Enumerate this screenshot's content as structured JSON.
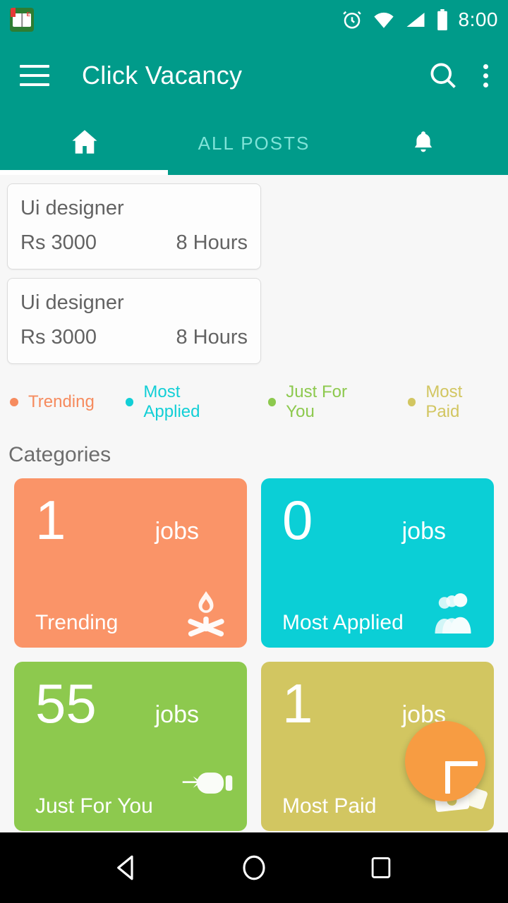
{
  "status_bar": {
    "notification_icon": "app-book-icon",
    "icons": [
      "alarm-icon",
      "wifi-icon",
      "signal-icon",
      "battery-icon"
    ],
    "time": "8:00"
  },
  "app_bar": {
    "menu_icon": "hamburger-menu-icon",
    "title": "Click Vacancy",
    "search_icon": "search-icon",
    "overflow_icon": "more-options-icon"
  },
  "tabs": [
    {
      "label": "",
      "icon": "home-icon",
      "active": true
    },
    {
      "label": "ALL POSTS",
      "icon": "",
      "active": false
    },
    {
      "label": "",
      "icon": "bell-icon",
      "active": false
    }
  ],
  "job_cards": [
    {
      "title": "Ui designer",
      "salary": "Rs 3000",
      "duration": "8 Hours"
    },
    {
      "title": "Ui designer",
      "salary": "Rs 3000",
      "duration": "8 Hours"
    }
  ],
  "legend": [
    {
      "label": "Trending",
      "color": "#f68b5e"
    },
    {
      "label": "Most Applied",
      "color": "#12cfd6"
    },
    {
      "label": "Just For You",
      "color": "#8dc94e"
    },
    {
      "label": "Most Paid",
      "color": "#d2c661"
    }
  ],
  "categories_section": {
    "title": "Categories",
    "cards": [
      {
        "count": "1",
        "unit": "jobs",
        "name": "Trending",
        "color": "#fa9468",
        "icon": "campfire-icon"
      },
      {
        "count": "0",
        "unit": "jobs",
        "name": "Most Applied",
        "color": "#0bcfd6",
        "icon": "people-group-icon"
      },
      {
        "count": "55",
        "unit": "jobs",
        "name": "Just For You",
        "color": "#8dc94e",
        "icon": "pointing-hand-icon"
      },
      {
        "count": "1",
        "unit": "jobs",
        "name": "Most Paid",
        "color": "#d2c661",
        "icon": "money-icon"
      }
    ]
  },
  "fab": {
    "icon": "plus-icon",
    "color": "#f79c42"
  },
  "nav_bar": {
    "back": "back-triangle-icon",
    "home": "home-circle-icon",
    "recents": "recents-square-icon"
  },
  "theme": {
    "primary": "#009b8a",
    "background": "#f7f7f7",
    "text_muted": "#636363"
  }
}
